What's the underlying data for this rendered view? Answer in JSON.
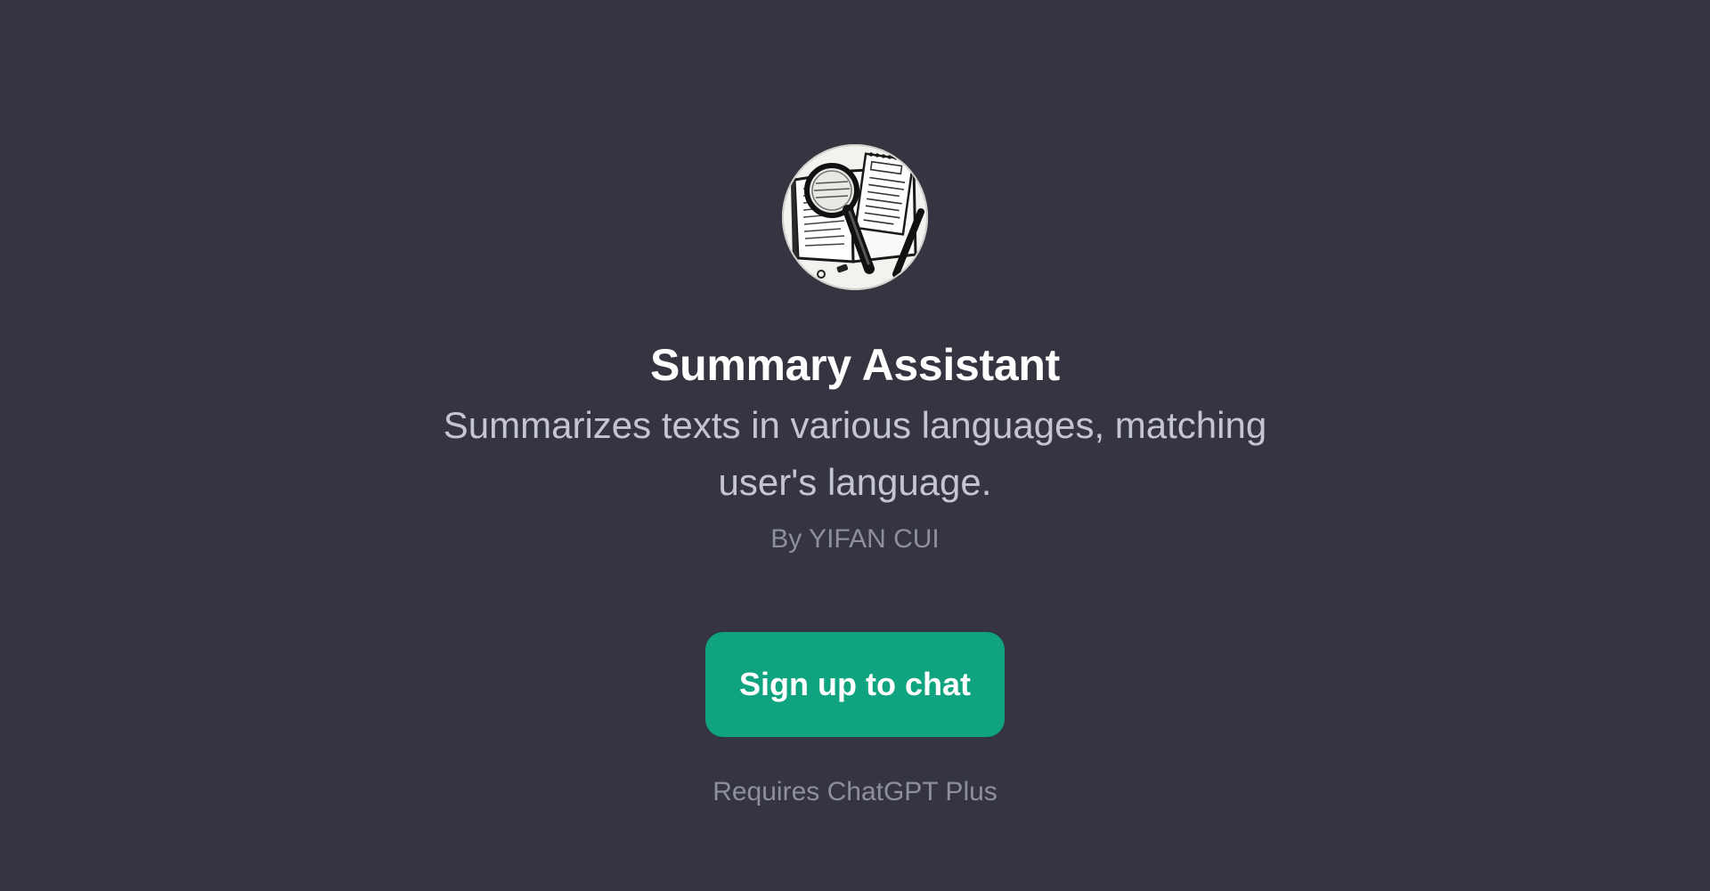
{
  "gpt": {
    "avatar_icon": "book-magnifier-illustration-icon",
    "title": "Summary Assistant",
    "description": "Summarizes texts in various languages, matching user's language.",
    "author": "By YIFAN CUI"
  },
  "actions": {
    "signup_label": "Sign up to chat",
    "requires_note": "Requires ChatGPT Plus"
  },
  "colors": {
    "background": "#343541",
    "button": "#10a37f",
    "title": "#ffffff",
    "description": "#c5c5d2",
    "muted": "#8e8ea0"
  }
}
